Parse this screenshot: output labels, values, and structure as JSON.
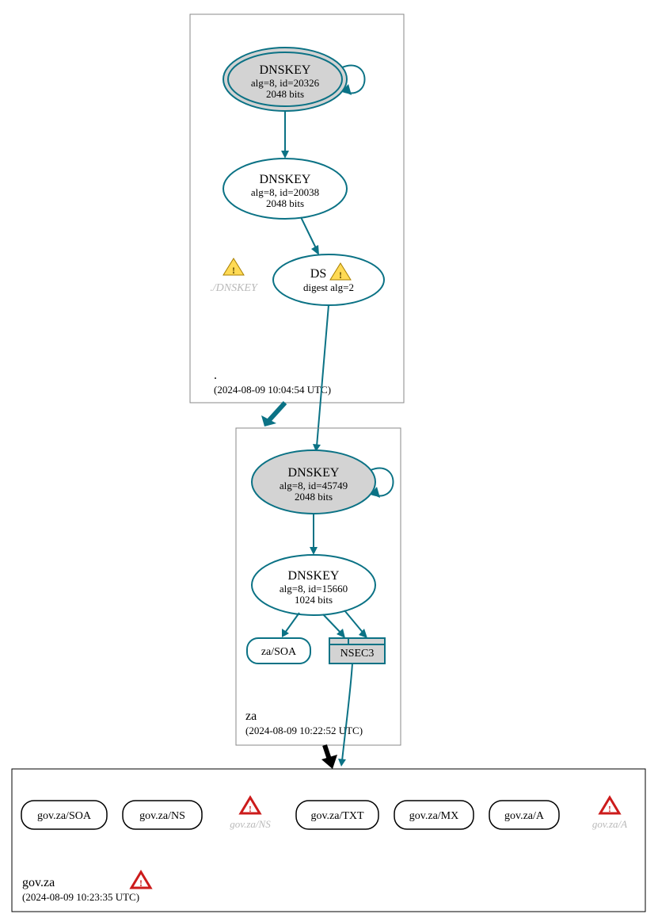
{
  "colors": {
    "teal": "#0b7285",
    "grey_fill": "#d3d3d3",
    "ghost_text": "#b9b9b9",
    "warn_yellow": "#ffda55",
    "error_red": "#cc1b1b"
  },
  "zone_root": {
    "label": ".",
    "timestamp": "(2024-08-09 10:04:54 UTC)",
    "dnskey_ksk": {
      "title": "DNSKEY",
      "line1": "alg=8, id=20326",
      "line2": "2048 bits"
    },
    "dnskey_zsk": {
      "title": "DNSKEY",
      "line1": "alg=8, id=20038",
      "line2": "2048 bits"
    },
    "ds": {
      "title": "DS",
      "line1": "digest alg=2",
      "warn": true
    },
    "ghost_dnskey": "./DNSKEY"
  },
  "zone_za": {
    "label": "za",
    "timestamp": "(2024-08-09 10:22:52 UTC)",
    "dnskey_ksk": {
      "title": "DNSKEY",
      "line1": "alg=8, id=45749",
      "line2": "2048 bits"
    },
    "dnskey_zsk": {
      "title": "DNSKEY",
      "line1": "alg=8, id=15660",
      "line2": "1024 bits"
    },
    "soa": "za/SOA",
    "nsec3": "NSEC3"
  },
  "zone_govza": {
    "label": "gov.za",
    "timestamp": "(2024-08-09 10:23:35 UTC)",
    "records": {
      "soa": "gov.za/SOA",
      "ns": "gov.za/NS",
      "txt": "gov.za/TXT",
      "mx": "gov.za/MX",
      "a": "gov.za/A"
    },
    "ghosts": {
      "ns": "gov.za/NS",
      "a": "gov.za/A"
    },
    "has_error": true
  }
}
